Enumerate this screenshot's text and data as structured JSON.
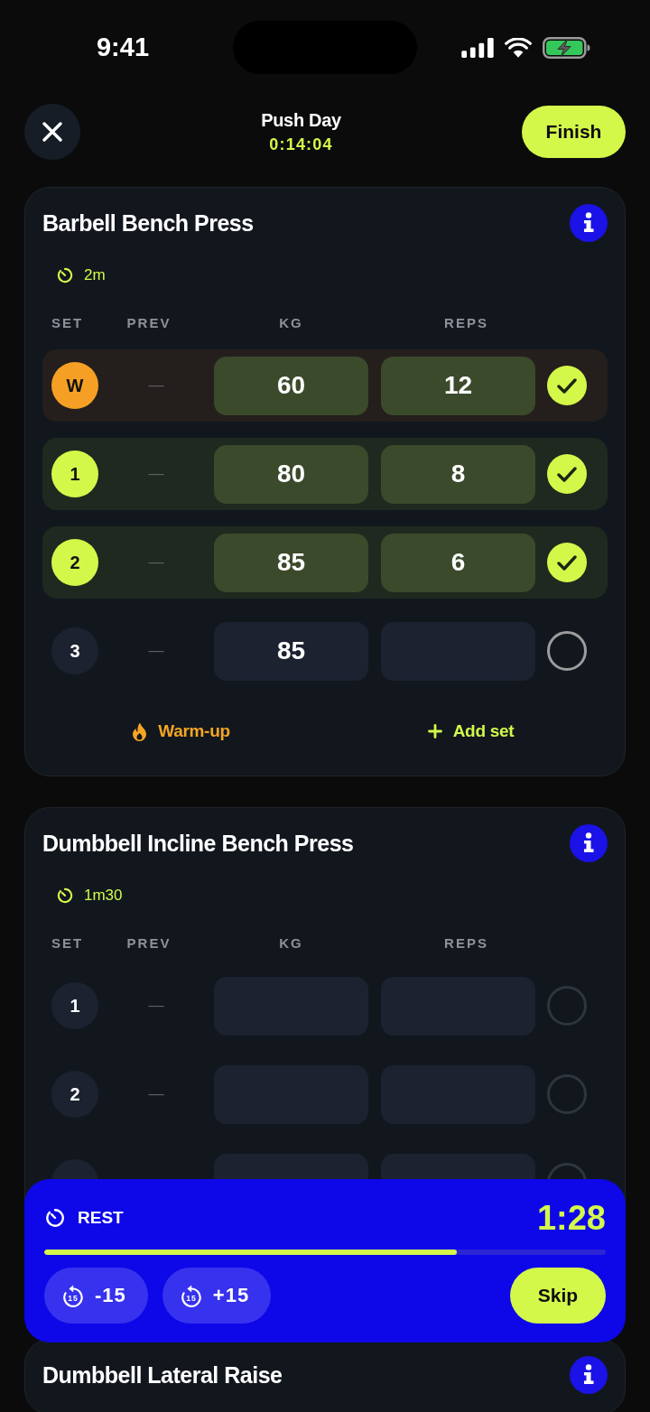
{
  "status_bar": {
    "time": "9:41"
  },
  "header": {
    "title": "Push Day",
    "elapsed": "0:14:04",
    "finish_label": "Finish"
  },
  "exercises": [
    {
      "name": "Barbell Bench Press",
      "rest": "2m",
      "columns": [
        "SET",
        "PREV",
        "KG",
        "REPS"
      ],
      "sets": [
        {
          "set": "W",
          "kind": "warmup",
          "prev": "—",
          "kg": "60",
          "reps": "12",
          "checked": true
        },
        {
          "set": "1",
          "kind": "normal",
          "prev": "—",
          "kg": "80",
          "reps": "8",
          "checked": true
        },
        {
          "set": "2",
          "kind": "normal",
          "prev": "—",
          "kg": "85",
          "reps": "6",
          "checked": true
        },
        {
          "set": "3",
          "kind": "normal",
          "prev": "—",
          "kg": "85",
          "checked": false,
          "current": true
        }
      ],
      "actions": [
        {
          "kind": "warmup",
          "label": "Warm-up"
        },
        {
          "kind": "add",
          "label": "Add set"
        }
      ]
    },
    {
      "name": "Dumbbell Incline Bench Press",
      "rest": "1m30",
      "columns": [
        "SET",
        "PREV",
        "KG",
        "REPS"
      ],
      "sets": [
        {
          "set": "1",
          "kind": "normal",
          "prev": "—",
          "checked": false,
          "current": false
        },
        {
          "set": "2",
          "kind": "normal",
          "prev": "—",
          "checked": false,
          "current": false
        },
        {
          "kind": "normal",
          "checked": false,
          "current": false
        }
      ]
    },
    {
      "name": "Dumbbell Lateral Raise"
    }
  ],
  "rest_timer": {
    "label": "REST",
    "remaining": "1:28",
    "level": 0.735,
    "buttons": [
      {
        "kind": "adjust",
        "icon_text": "15",
        "label": "-15"
      },
      {
        "kind": "adjust",
        "icon_text": "15",
        "label": "+15"
      },
      {
        "kind": "skip",
        "label": "Skip"
      }
    ]
  }
}
